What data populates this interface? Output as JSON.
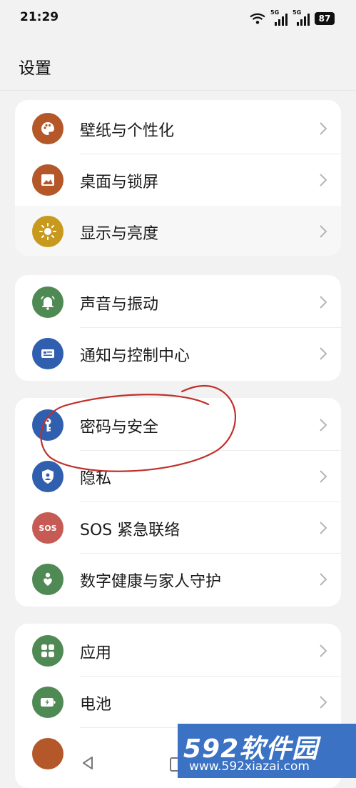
{
  "status_bar": {
    "time": "21:29",
    "network_1": "5G",
    "network_2": "5G",
    "battery": "87"
  },
  "header": {
    "title": "设置"
  },
  "groups": [
    {
      "items": [
        {
          "label": "壁纸与个性化",
          "icon": "palette-icon",
          "color": "#b4582a"
        },
        {
          "label": "桌面与锁屏",
          "icon": "image-icon",
          "color": "#b4582a"
        },
        {
          "label": "显示与亮度",
          "icon": "sun-icon",
          "color": "#c79a1e"
        }
      ]
    },
    {
      "items": [
        {
          "label": "声音与振动",
          "icon": "bell-icon",
          "color": "#4f8a55"
        },
        {
          "label": "通知与控制中心",
          "icon": "notification-icon",
          "color": "#2f5fae"
        }
      ]
    },
    {
      "items": [
        {
          "label": "密码与安全",
          "icon": "key-icon",
          "color": "#2f5fae"
        },
        {
          "label": "隐私",
          "icon": "shield-icon",
          "color": "#2f5fae"
        },
        {
          "label": "SOS 紧急联络",
          "icon": "sos-icon",
          "icon_text": "SOS",
          "color": "#c65b55"
        },
        {
          "label": "数字健康与家人守护",
          "icon": "heart-person-icon",
          "color": "#4f8a55"
        }
      ]
    },
    {
      "items": [
        {
          "label": "应用",
          "icon": "apps-grid-icon",
          "color": "#4f8a55"
        },
        {
          "label": "电池",
          "icon": "battery-icon",
          "color": "#4f8a55"
        }
      ]
    }
  ],
  "watermark": {
    "logo": "592软件园",
    "url": "www.592xiazai.com"
  },
  "colors": {
    "background": "#f2f2f3",
    "card": "#ffffff",
    "annotation": "#c0302b",
    "watermark": "#3b72c4"
  }
}
